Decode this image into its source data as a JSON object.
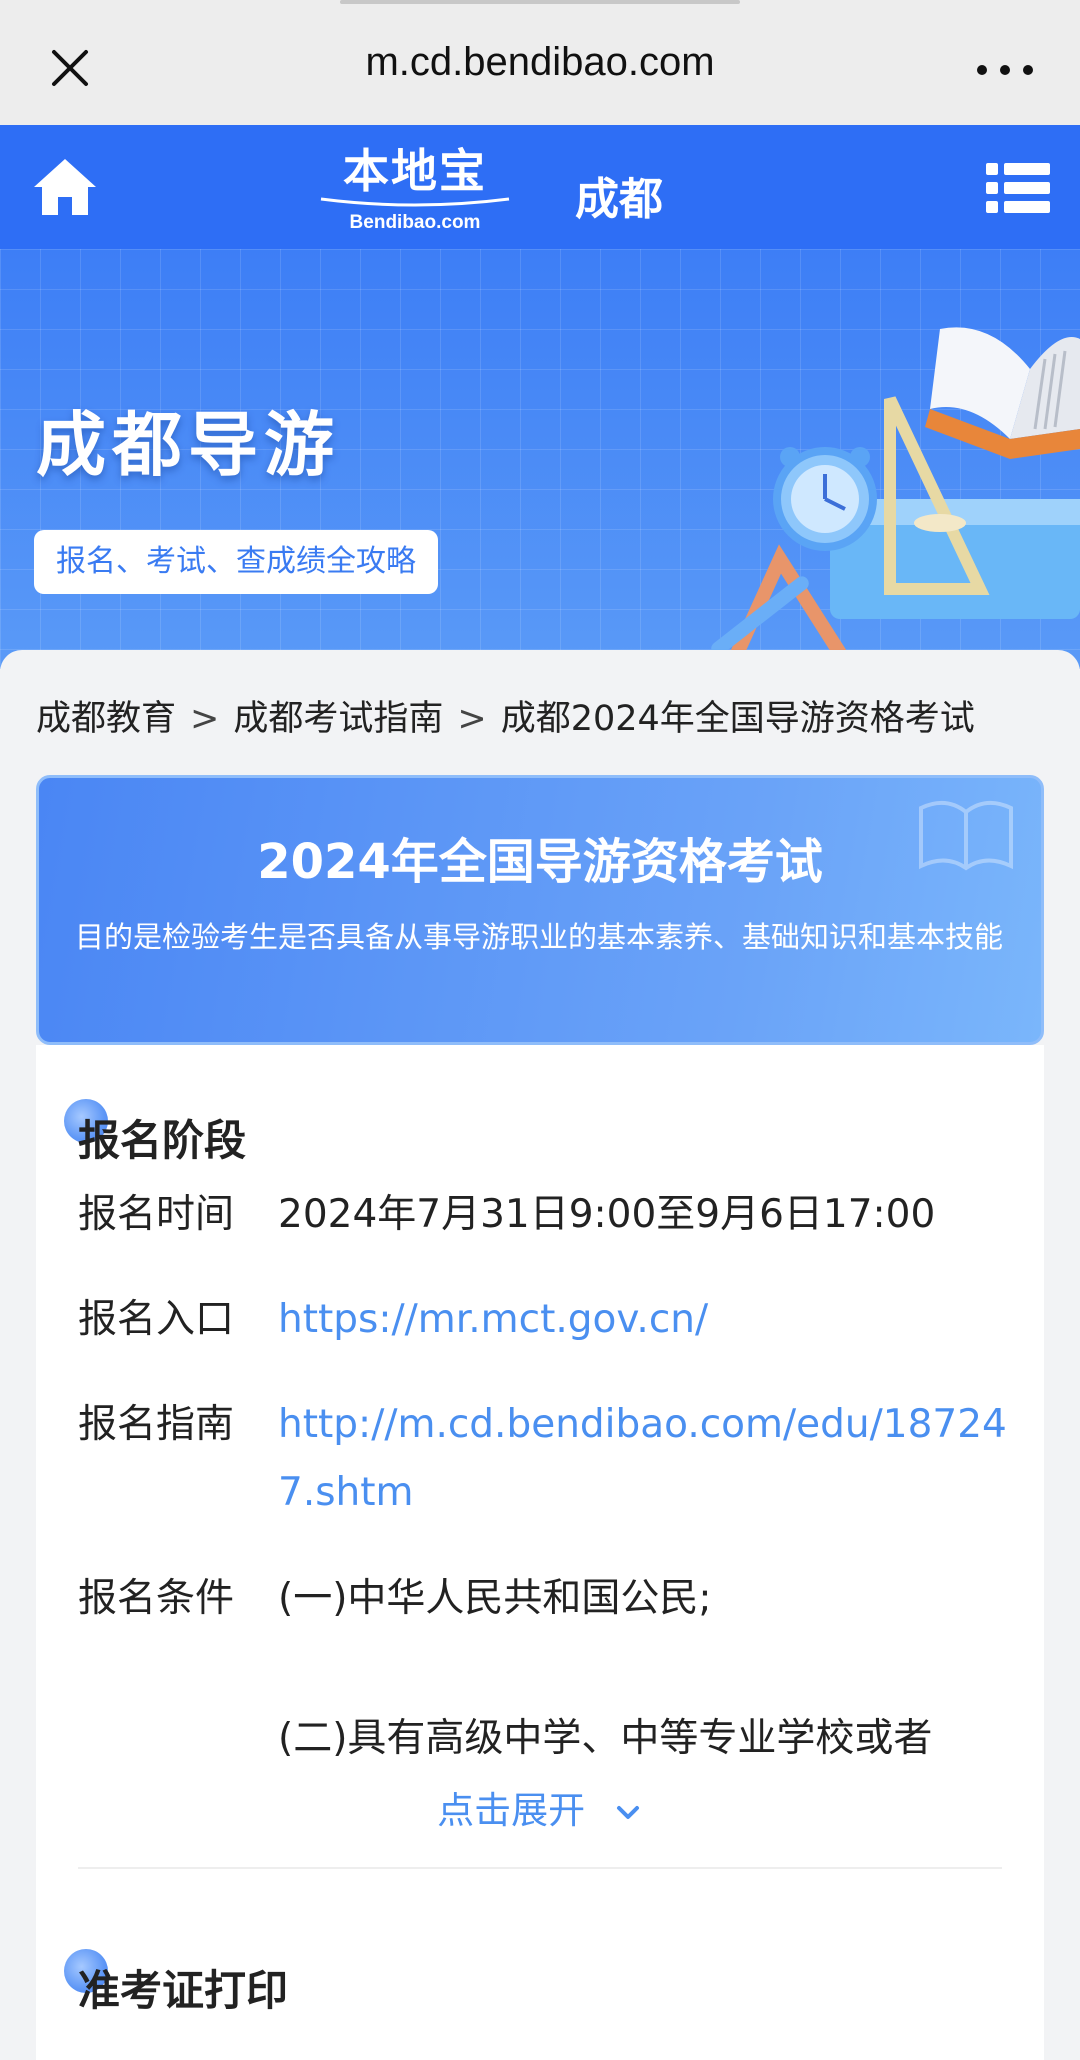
{
  "browser": {
    "url": "m.cd.bendibao.com"
  },
  "header": {
    "logo_cn": "本地宝",
    "logo_en": "Bendibao.com",
    "city": "成都"
  },
  "banner": {
    "title": "成都导游",
    "tagline": "报名、考试、查成绩全攻略"
  },
  "breadcrumb": {
    "items": [
      "成都教育",
      "成都考试指南",
      "成都2024年全国导游资格考试"
    ],
    "separator": ">"
  },
  "exam": {
    "title": "2024年全国导游资格考试",
    "description": "目的是检验考生是否具备从事导游职业的基本素养、基础知识和基本技能"
  },
  "registration": {
    "heading": "报名阶段",
    "rows": [
      {
        "label": "报名时间",
        "value": "2024年7月31日9:00至9月6日17:00"
      },
      {
        "label": "报名入口",
        "value": "https://mr.mct.gov.cn/"
      },
      {
        "label": "报名指南",
        "value": "http://m.cd.bendibao.com/edu/187247.shtm"
      },
      {
        "label": "报名条件",
        "value": "(一)中华人民共和国公民;"
      }
    ],
    "condition_2": "(二)具有高级中学、中等专业学校或者",
    "expand_label": "点击展开"
  },
  "next_section": {
    "heading": "准考证打印"
  },
  "colors": {
    "brand_blue": "#2e6ef5",
    "link_blue": "#4a8ff0"
  }
}
